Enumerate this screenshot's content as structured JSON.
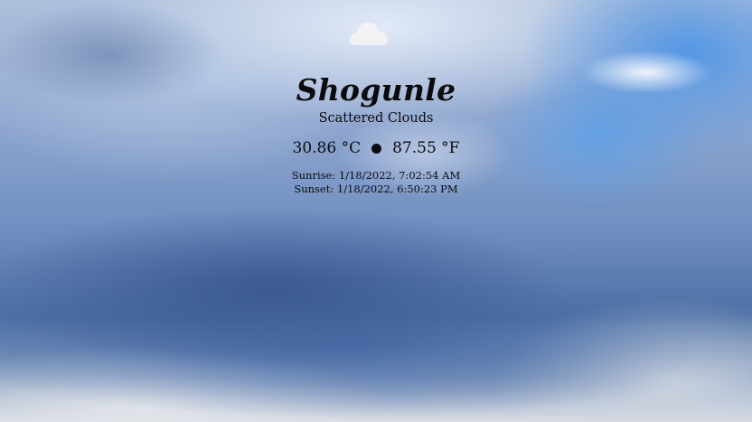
{
  "weather": {
    "icon": "cloud-icon",
    "city": "Shogunle",
    "condition": "Scattered Clouds",
    "temp_c": "30.86 °C",
    "temp_f": "87.55 °F",
    "sunrise": "Sunrise: 1/18/2022, 7:02:54 AM",
    "sunset": "Sunset: 1/18/2022, 6:50:23 PM"
  },
  "colors": {
    "text": "#0b0b0b",
    "icon": "#f2f2f2"
  }
}
